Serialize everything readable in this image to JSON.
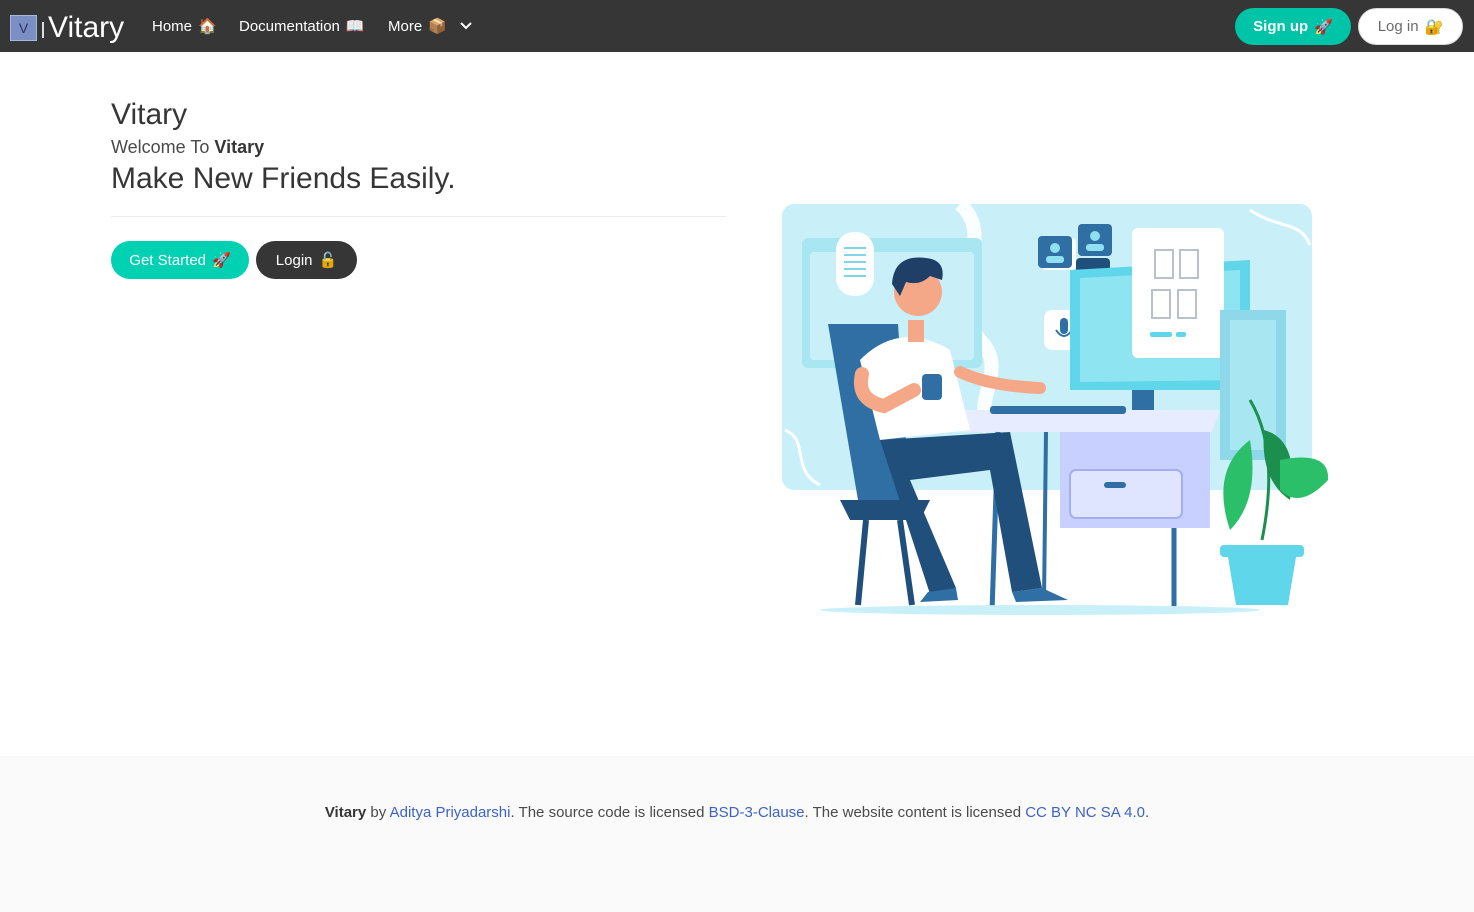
{
  "navbar": {
    "logo_letter": "V",
    "brand": "Vitary",
    "items": [
      {
        "label": "Home",
        "emoji": "🏠"
      },
      {
        "label": "Documentation",
        "emoji": "📖"
      },
      {
        "label": "More",
        "emoji": "📦"
      }
    ],
    "more_chevron": "⌄",
    "signup_label": "Sign up",
    "signup_emoji": "🚀",
    "login_label": "Log in",
    "login_emoji": "🔐"
  },
  "hero": {
    "title": "Vitary",
    "welcome_prefix": "Welcome To ",
    "welcome_brand": "Vitary",
    "tagline": "Make New Friends Easily.",
    "get_started_label": "Get Started",
    "get_started_emoji": "🚀",
    "login_label": "Login",
    "login_emoji": "🔓"
  },
  "footer": {
    "brand": "Vitary",
    "by": " by ",
    "author": "Aditya Priyadarshi",
    "text1": ". The source code is licensed ",
    "code_license": "BSD-3-Clause",
    "text2": ". The website content is licensed ",
    "content_license": "CC BY NC SA 4.0",
    "text3": "."
  },
  "colors": {
    "navbar": "#363636",
    "primary": "#00d1b2",
    "link": "#3e63c7"
  }
}
